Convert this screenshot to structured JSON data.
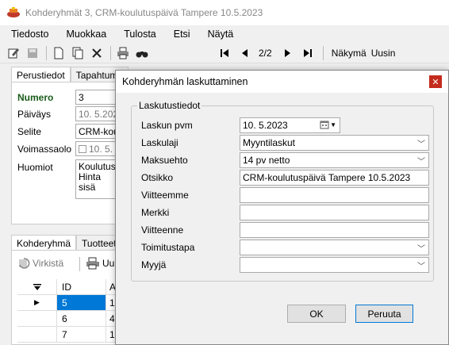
{
  "window": {
    "title": "Kohderyhmät 3, CRM-koulutuspäivä Tampere 10.5.2023"
  },
  "menu": {
    "items": [
      "Tiedosto",
      "Muokkaa",
      "Tulosta",
      "Etsi",
      "Näytä"
    ]
  },
  "toolbar": {
    "record_nav": "2/2",
    "view_label": "Näkymä",
    "view_value": "Uusin"
  },
  "form": {
    "tabs": [
      "Perustiedot",
      "Tapahtuma"
    ],
    "fields": {
      "numero_label": "Numero",
      "numero_value": "3",
      "paivays_label": "Päiväys",
      "paivays_value": "10.  5.202",
      "selite_label": "Selite",
      "selite_value": "CRM-koulu",
      "voimassaolo_label": "Voimassaolo",
      "voimassaolo_value": "10.  5.",
      "huomiot_label": "Huomiot",
      "huomiot_value": "Koulutusp\nHinta sisä"
    },
    "bottom_tabs": [
      "Kohderyhmä",
      "Tuotteet"
    ],
    "refresh_label": "Virkistä",
    "u_label": "Uu",
    "grid": {
      "header": [
        "",
        "ID",
        "A"
      ],
      "rows": [
        {
          "marker": "▶",
          "id": "5",
          "extra": "1"
        },
        {
          "marker": "",
          "id": "6",
          "extra": "4"
        },
        {
          "marker": "",
          "id": "7",
          "extra": "1"
        }
      ]
    }
  },
  "dialog": {
    "title": "Kohderyhmän laskuttaminen",
    "group_title": "Laskutustiedot",
    "fields": {
      "laskun_pvm_label": "Laskun pvm",
      "laskun_pvm_value": "10.  5.2023",
      "laskulaji_label": "Laskulaji",
      "laskulaji_value": "Myyntilaskut",
      "maksuehto_label": "Maksuehto",
      "maksuehto_value": "14 pv netto",
      "otsikko_label": "Otsikko",
      "otsikko_value": "CRM-koulutuspäivä Tampere 10.5.2023",
      "viitteemme_label": "Viitteemme",
      "viitteemme_value": "",
      "merkki_label": "Merkki",
      "merkki_value": "",
      "viitteenne_label": "Viitteenne",
      "viitteenne_value": "",
      "toimitustapa_label": "Toimitustapa",
      "toimitustapa_value": "",
      "myyja_label": "Myyjä",
      "myyja_value": ""
    },
    "ok_label": "OK",
    "cancel_label": "Peruuta"
  },
  "colors": {
    "accent": "#0078d7",
    "close": "#c42b1c",
    "numero_green": "#1a5c1a"
  }
}
